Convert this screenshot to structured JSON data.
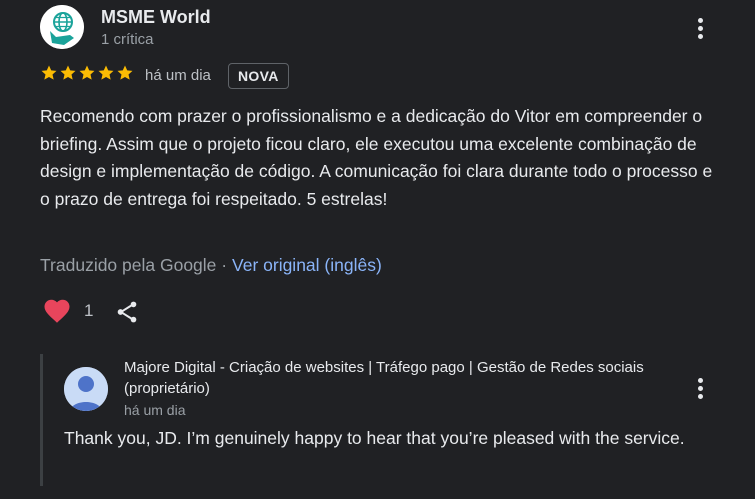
{
  "review": {
    "author": "MSME World",
    "meta": "1 crítica",
    "rating": 5,
    "max_rating": 5,
    "time": "há um dia",
    "badge": "NOVA",
    "text": "Recomendo com prazer o profissionalismo e a dedicação do Vitor em compreender o briefing. Assim que o projeto ficou claro, ele executou uma excelente combinação de design e implementação de código. A comunicação foi clara durante todo o processo e o prazo de entrega foi respeitado. 5 estrelas!",
    "translated_by": "Traduzido pela Google",
    "separator": "·",
    "view_original": "Ver original (inglês)",
    "likes": "1"
  },
  "reply": {
    "owner_name": "Majore Digital - Criação de websites | Tráfego pago | Gestão de Redes sociais (proprietário)",
    "time": "há um dia",
    "text": "Thank you, JD. I’m genuinely happy to hear that you’re pleased with the service."
  },
  "icons": {
    "author_avatar": "globe-hand-logo-icon",
    "more": "more-vert-icon",
    "star": "star-icon",
    "like": "heart-icon",
    "share": "share-icon",
    "owner_avatar": "person-avatar-icon"
  },
  "colors": {
    "background": "#202124",
    "star": "#fbbc04",
    "heart": "#e8455c",
    "link": "#8ab4f8",
    "logo_teal": "#1aa39a"
  }
}
